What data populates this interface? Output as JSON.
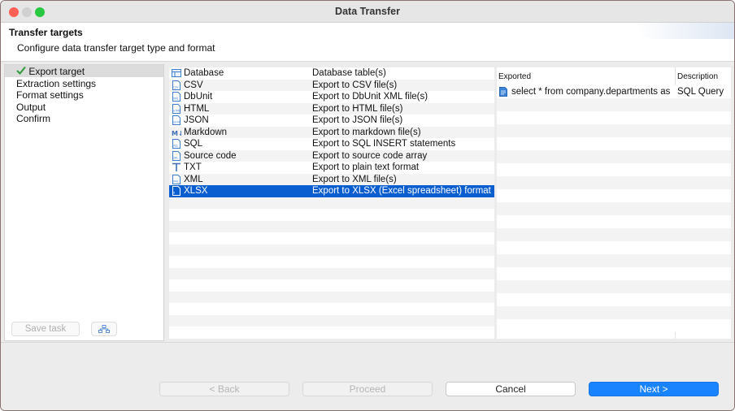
{
  "window": {
    "title": "Data Transfer",
    "traffic_lights": {
      "close": "#ff5f57",
      "minimize": "#febc2e",
      "maximize": "#28c840"
    }
  },
  "header": {
    "title": "Transfer targets",
    "subtitle": "Configure data transfer target type and format"
  },
  "nav": {
    "items": [
      {
        "label": "Export target",
        "selected": true,
        "checked": true
      },
      {
        "label": "Extraction settings"
      },
      {
        "label": "Format settings"
      },
      {
        "label": "Output"
      },
      {
        "label": "Confirm"
      }
    ],
    "save_task_label": "Save task",
    "tree_button_icon": "tree-structure-icon"
  },
  "formats": {
    "rows": [
      {
        "name": "Database",
        "description": "Database table(s)",
        "icon": "database-table-icon"
      },
      {
        "name": "CSV",
        "description": "Export to CSV file(s)",
        "icon": "csv-file-icon",
        "icon_text": "CSV"
      },
      {
        "name": "DbUnit",
        "description": "Export to DbUnit XML file(s)",
        "icon": "xml-file-icon",
        "icon_text": "XML"
      },
      {
        "name": "HTML",
        "description": "Export to HTML file(s)",
        "icon": "html-file-icon",
        "icon_text": "HTML"
      },
      {
        "name": "JSON",
        "description": "Export to JSON file(s)",
        "icon": "json-file-icon",
        "icon_text": "JSON"
      },
      {
        "name": "Markdown",
        "description": "Export to markdown file(s)",
        "icon": "markdown-icon",
        "icon_text": "M↓"
      },
      {
        "name": "SQL",
        "description": "Export to SQL INSERT statements",
        "icon": "sql-file-icon",
        "icon_text": "SQL"
      },
      {
        "name": "Source code",
        "description": "Export to source code array",
        "icon": "source-code-file-icon",
        "icon_text": "SRC"
      },
      {
        "name": "TXT",
        "description": "Export to plain text format",
        "icon": "text-format-icon",
        "icon_text": "T"
      },
      {
        "name": "XML",
        "description": "Export to XML file(s)",
        "icon": "xml-file-icon",
        "icon_text": "XML"
      },
      {
        "name": "XLSX",
        "description": "Export to XLSX (Excel spreadsheet) format",
        "icon": "excel-file-icon",
        "icon_text": "X",
        "selected": true
      }
    ],
    "selected_color": "#0a5ecf"
  },
  "exported": {
    "headers": {
      "exported": "Exported",
      "description": "Description"
    },
    "rows": [
      {
        "exported": "select * from company.departments as d",
        "description": "SQL Query",
        "icon": "sql-script-icon"
      }
    ]
  },
  "footer": {
    "back_label": "< Back",
    "proceed_label": "Proceed",
    "cancel_label": "Cancel",
    "next_label": "Next >",
    "accent": "#1a84ff"
  }
}
